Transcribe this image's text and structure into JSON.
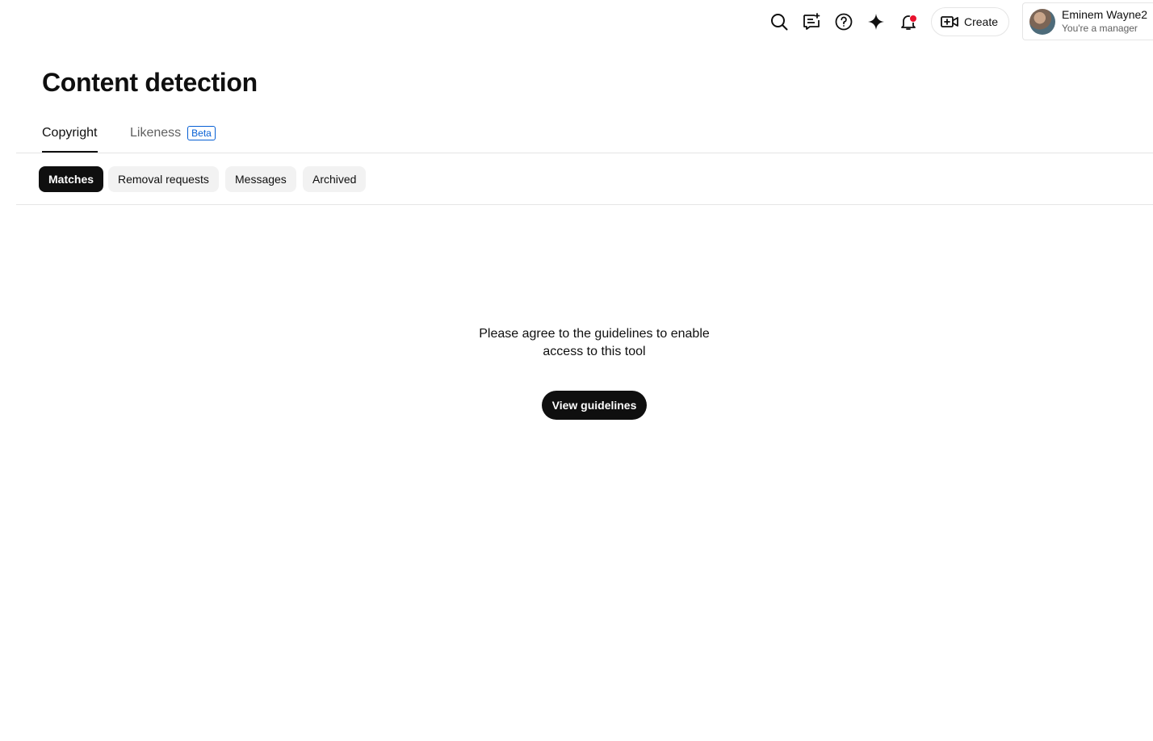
{
  "header": {
    "icons": {
      "search": "search-icon",
      "feedback": "feedback-icon",
      "help": "help-icon",
      "ai": "sparkle-icon",
      "notifications": "bell-icon"
    },
    "create_label": "Create",
    "account": {
      "name": "Eminem Wayne2",
      "role": "You're a manager"
    },
    "notification_dot_color": "#e8112d"
  },
  "page": {
    "title": "Content detection"
  },
  "tabs": [
    {
      "label": "Copyright",
      "active": true
    },
    {
      "label": "Likeness",
      "badge": "Beta",
      "active": false
    }
  ],
  "chips": [
    {
      "label": "Matches",
      "selected": true
    },
    {
      "label": "Removal requests",
      "selected": false
    },
    {
      "label": "Messages",
      "selected": false
    },
    {
      "label": "Archived",
      "selected": false
    }
  ],
  "empty_state": {
    "message": "Please agree to the guidelines to enable access to this tool",
    "button_label": "View guidelines"
  },
  "colors": {
    "accent": "#065fd4",
    "text": "#0f0f0f",
    "muted": "#606060"
  }
}
